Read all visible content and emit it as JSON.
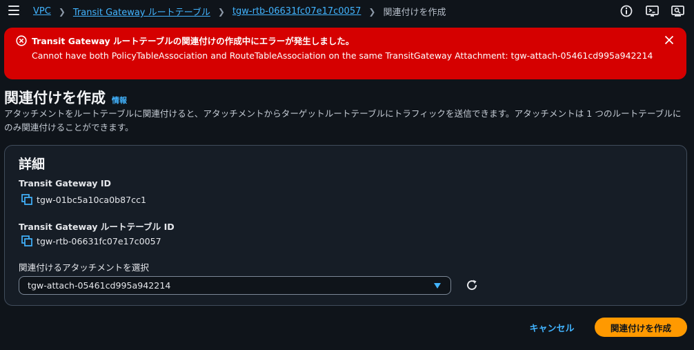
{
  "breadcrumb": {
    "items": [
      "VPC",
      "Transit Gateway ルートテーブル",
      "tgw-rtb-06631fc07e17c0057"
    ],
    "current": "関連付けを作成"
  },
  "top_icons": [
    "info-circle-icon",
    "cloudshell-icon",
    "notifications-icon"
  ],
  "alert": {
    "title": "Transit Gateway ルートテーブルの関連付けの作成中にエラーが発生しました。",
    "message": "Cannot have both PolicyTableAssociation and RouteTableAssociation on the same TransitGateway Attachment: tgw-attach-05461cd995a942214",
    "color": "#d50000"
  },
  "page": {
    "title": "関連付けを作成",
    "info_link": "情報",
    "description": "アタッチメントをルートテーブルに関連付けると、アタッチメントからターゲットルートテーブルにトラフィックを送信できます。アタッチメントは 1 つのルートテーブルにのみ関連付けることができます。"
  },
  "details": {
    "heading": "詳細",
    "tgw_label": "Transit Gateway ID",
    "tgw_value": "tgw-01bc5a10ca0b87cc1",
    "rtb_label": "Transit Gateway ルートテーブル ID",
    "rtb_value": "tgw-rtb-06631fc07e17c0057",
    "select_label": "関連付けるアタッチメントを選択",
    "select_value": "tgw-attach-05461cd995a942214"
  },
  "actions": {
    "cancel": "キャンセル",
    "create": "関連付けを作成"
  },
  "colors": {
    "accent": "#42b4ff",
    "primary_button": "#ff9900",
    "background": "#0f141a"
  }
}
